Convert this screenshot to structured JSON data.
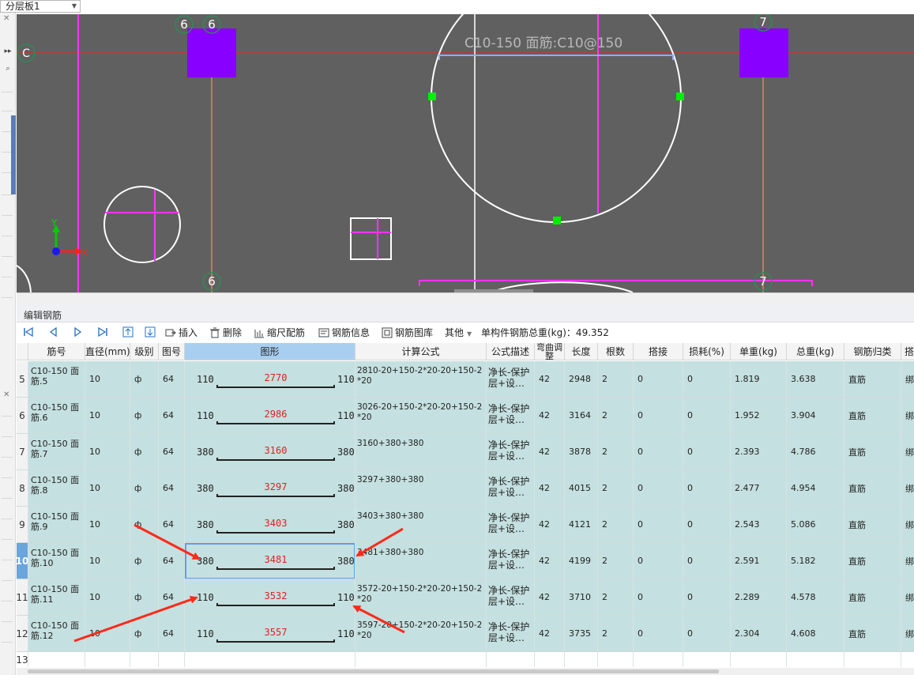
{
  "layer_selector": {
    "value": "分层板1"
  },
  "viewport": {
    "axis_labels": {
      "c": "C",
      "six_a": "6",
      "six_b": "6",
      "six_c": "6",
      "seven_a": "7",
      "seven_b": "7"
    },
    "rebar_label": "C10-150 面筋:C10@150",
    "ucs": {
      "x": "X",
      "y": "Y"
    },
    "colors": {
      "background": "#606060",
      "magenta": "#ff33ff",
      "purple": "#8800ff",
      "green": "#00ff00",
      "axis_red": "#ff2020",
      "orange": "#ffa070"
    }
  },
  "panel": {
    "title": "编辑钢筋"
  },
  "toolbar": {
    "insert": "插入",
    "delete": "删除",
    "scale": "缩尺配筋",
    "info": "钢筋信息",
    "library": "钢筋图库",
    "other": "其他",
    "total_weight": "单构件钢筋总重(kg)：49.352"
  },
  "table": {
    "headers": {
      "name": "筋号",
      "diameter": "直径(mm)",
      "grade": "级别",
      "fig_no": "图号",
      "shape": "图形",
      "formula": "计算公式",
      "desc": "公式描述",
      "bend": "弯曲调整",
      "length": "长度",
      "count": "根数",
      "lap": "搭接",
      "loss": "损耗(%)",
      "unit_w": "单重(kg)",
      "total_w": "总重(kg)",
      "category": "钢筋归类",
      "last": "搭"
    },
    "rows": [
      {
        "no": "5",
        "name": "C10-150 面筋.5",
        "diameter": "10",
        "grade": "ф",
        "fig_no": "64",
        "left": "110",
        "mid": "2770",
        "right": "110",
        "formula": "2810-20+150-2*20-20+150-2*20",
        "desc": "净长-保护层+设…",
        "bend": "42",
        "length": "2948",
        "count": "2",
        "lap": "0",
        "loss": "0",
        "unit_w": "1.819",
        "total_w": "3.638",
        "category": "直筋",
        "last": "绑"
      },
      {
        "no": "6",
        "name": "C10-150 面筋.6",
        "diameter": "10",
        "grade": "ф",
        "fig_no": "64",
        "left": "110",
        "mid": "2986",
        "right": "110",
        "formula": "3026-20+150-2*20-20+150-2*20",
        "desc": "净长-保护层+设…",
        "bend": "42",
        "length": "3164",
        "count": "2",
        "lap": "0",
        "loss": "0",
        "unit_w": "1.952",
        "total_w": "3.904",
        "category": "直筋",
        "last": "绑"
      },
      {
        "no": "7",
        "name": "C10-150 面筋.7",
        "diameter": "10",
        "grade": "ф",
        "fig_no": "64",
        "left": "380",
        "mid": "3160",
        "right": "380",
        "formula": "3160+380+380",
        "desc": "净长-保护层+设…",
        "bend": "42",
        "length": "3878",
        "count": "2",
        "lap": "0",
        "loss": "0",
        "unit_w": "2.393",
        "total_w": "4.786",
        "category": "直筋",
        "last": "绑"
      },
      {
        "no": "8",
        "name": "C10-150 面筋.8",
        "diameter": "10",
        "grade": "ф",
        "fig_no": "64",
        "left": "380",
        "mid": "3297",
        "right": "380",
        "formula": "3297+380+380",
        "desc": "净长-保护层+设…",
        "bend": "42",
        "length": "4015",
        "count": "2",
        "lap": "0",
        "loss": "0",
        "unit_w": "2.477",
        "total_w": "4.954",
        "category": "直筋",
        "last": "绑"
      },
      {
        "no": "9",
        "name": "C10-150 面筋.9",
        "diameter": "10",
        "grade": "ф",
        "fig_no": "64",
        "left": "380",
        "mid": "3403",
        "right": "380",
        "formula": "3403+380+380",
        "desc": "净长-保护层+设…",
        "bend": "42",
        "length": "4121",
        "count": "2",
        "lap": "0",
        "loss": "0",
        "unit_w": "2.543",
        "total_w": "5.086",
        "category": "直筋",
        "last": "绑"
      },
      {
        "no": "10",
        "name": "C10-150 面筋.10",
        "diameter": "10",
        "grade": "ф",
        "fig_no": "64",
        "left": "380",
        "mid": "3481",
        "right": "380",
        "formula": "3481+380+380",
        "desc": "净长-保护层+设…",
        "bend": "42",
        "length": "4199",
        "count": "2",
        "lap": "0",
        "loss": "0",
        "unit_w": "2.591",
        "total_w": "5.182",
        "category": "直筋",
        "last": "绑"
      },
      {
        "no": "11",
        "name": "C10-150 面筋.11",
        "diameter": "10",
        "grade": "ф",
        "fig_no": "64",
        "left": "110",
        "mid": "3532",
        "right": "110",
        "formula": "3572-20+150-2*20-20+150-2*20",
        "desc": "净长-保护层+设…",
        "bend": "42",
        "length": "3710",
        "count": "2",
        "lap": "0",
        "loss": "0",
        "unit_w": "2.289",
        "total_w": "4.578",
        "category": "直筋",
        "last": "绑"
      },
      {
        "no": "12",
        "name": "C10-150 面筋.12",
        "diameter": "10",
        "grade": "ф",
        "fig_no": "64",
        "left": "110",
        "mid": "3557",
        "right": "110",
        "formula": "3597-20+150-2*20-20+150-2*20",
        "desc": "净长-保护层+设…",
        "bend": "42",
        "length": "3735",
        "count": "2",
        "lap": "0",
        "loss": "0",
        "unit_w": "2.304",
        "total_w": "4.608",
        "category": "直筋",
        "last": "绑"
      }
    ],
    "empty_row_no": "13",
    "selected_row": "10"
  }
}
